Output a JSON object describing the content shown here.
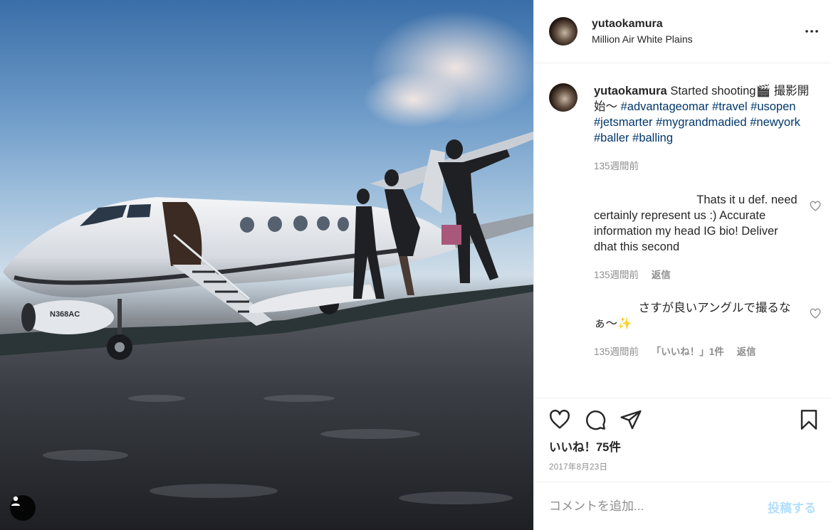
{
  "post": {
    "username": "yutaokamura",
    "location": "Million Air White Plains",
    "image_alt": "Private jet on tarmac with people posing",
    "jet_tail_number": "N368AC"
  },
  "caption": {
    "username": "yutaokamura",
    "text": "Started shooting🎬 撮影開始〜 ",
    "hashtags": [
      "#advantageomar",
      "#travel",
      "#usopen",
      "#jetsmarter",
      "#mygrandmadied",
      "#newyork",
      "#baller",
      "#balling"
    ],
    "time": "135週間前"
  },
  "comments": [
    {
      "user_hidden": "– . .",
      "text": "Thats it u def. need certainly represent us :) Accurate information my head IG bio! Deliver dhat this second",
      "time": "135週間前",
      "reply_label": "返信"
    },
    {
      "text": "さすが良いアングルで撮るなぁ〜✨",
      "time": "135週間前",
      "likes_label": "「いいね！」1件",
      "reply_label": "返信"
    }
  ],
  "actions": {
    "like_icon": "heart-icon",
    "comment_icon": "comment-icon",
    "share_icon": "share-icon",
    "save_icon": "bookmark-icon"
  },
  "likes_text": "いいね！75件",
  "date": "2017年8月23日",
  "comment_box": {
    "placeholder": "コメントを追加...",
    "post_label": "投稿する"
  },
  "colors": {
    "hashtag": "#00376b",
    "meta": "#8e8e8e",
    "post_disabled": "#b2dffc"
  }
}
